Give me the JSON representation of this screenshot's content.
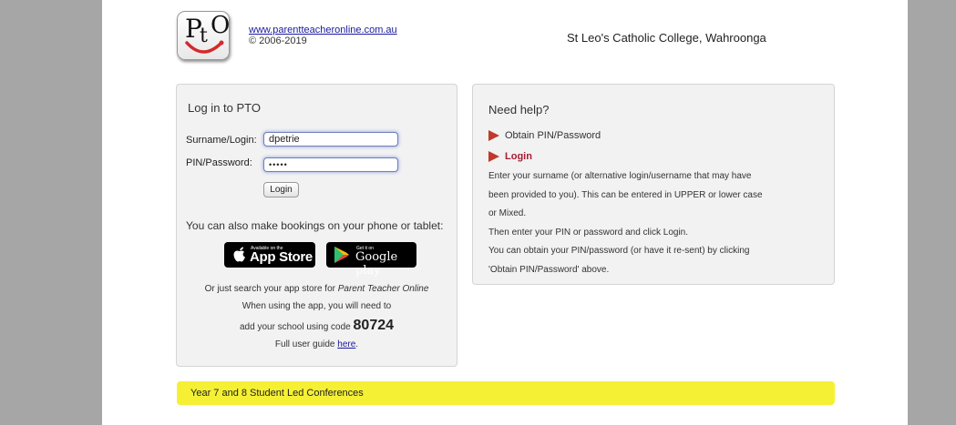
{
  "header": {
    "logo_text": "PtO",
    "site_url": "www.parentteacheronline.com.au",
    "copyright": "© 2006-2019",
    "school_name": "St Leo's Catholic College, Wahroonga"
  },
  "login": {
    "title": "Log in to PTO",
    "surname_label": "Surname/Login:",
    "surname_value": "dpetrie",
    "pin_label": "PIN/Password:",
    "pin_value": "•••••",
    "login_button": "Login",
    "mobile_text": "You can also make bookings on your phone or tablet:",
    "app_store": {
      "small": "Available on the",
      "big": "App Store"
    },
    "google_play": {
      "small": "Get it on",
      "big": "Google play"
    },
    "search_prefix": "Or just search your app store for ",
    "search_app_name": "Parent Teacher Online",
    "app_note": "When using the app, you will need to",
    "code_prefix": "add your school using code ",
    "school_code": "80724",
    "guide_prefix": "Full user guide ",
    "guide_link": "here",
    "guide_suffix": "."
  },
  "help": {
    "title": "Need help?",
    "items": [
      {
        "label": "Obtain PIN/Password",
        "active": false
      },
      {
        "label": "Login",
        "active": true
      }
    ],
    "lines": [
      "Enter your surname (or alternative login/username that may have",
      "been provided to you). This can be entered in UPPER or lower case",
      "or Mixed.",
      "Then enter your PIN or password and click Login.",
      "You can obtain your PIN/password (or have it re-sent) by clicking",
      "'Obtain PIN/Password' above."
    ]
  },
  "banner": {
    "text": "Year 7 and 8 Student Led Conferences"
  },
  "colors": {
    "accent": "#a51c30",
    "banner": "#f6f034",
    "link": "#1a1a9e"
  }
}
